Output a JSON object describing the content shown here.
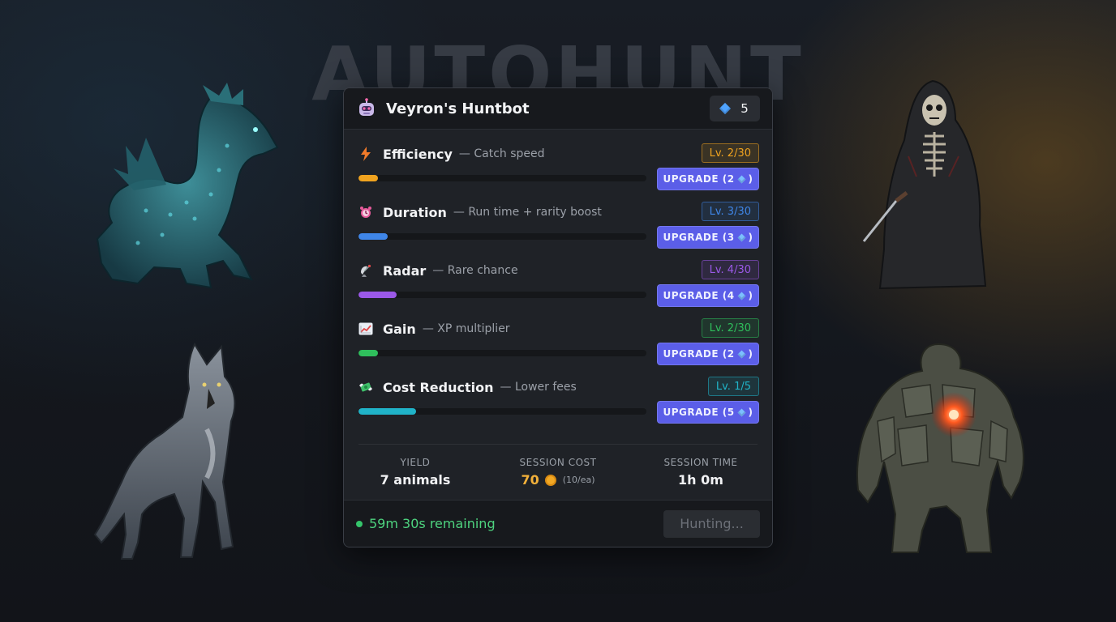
{
  "background_title": "AUTOHUNT",
  "panel": {
    "title": "Veyron's Huntbot",
    "gems": "5"
  },
  "stats": [
    {
      "name": "Efficiency",
      "desc": "— Catch speed",
      "level": "Lv. 2/30",
      "upgrade": "UPGRADE (2",
      "upgrade_end": ")",
      "progress": 0.067,
      "color": "#f0a31f",
      "icon": "lightning-icon"
    },
    {
      "name": "Duration",
      "desc": "— Run time + rarity boost",
      "level": "Lv. 3/30",
      "upgrade": "UPGRADE (3",
      "upgrade_end": ")",
      "progress": 0.1,
      "color": "#3f86e8",
      "icon": "alarm-clock-icon"
    },
    {
      "name": "Radar",
      "desc": "— Rare chance",
      "level": "Lv. 4/30",
      "upgrade": "UPGRADE (4",
      "upgrade_end": ")",
      "progress": 0.133,
      "color": "#9b59e8",
      "icon": "satellite-dish-icon"
    },
    {
      "name": "Gain",
      "desc": "— XP multiplier",
      "level": "Lv. 2/30",
      "upgrade": "UPGRADE (2",
      "upgrade_end": ")",
      "progress": 0.067,
      "color": "#2fbf5c",
      "icon": "chart-up-icon"
    },
    {
      "name": "Cost Reduction",
      "desc": "— Lower fees",
      "level": "Lv. 1/5",
      "upgrade": "UPGRADE (5",
      "upgrade_end": ")",
      "progress": 0.2,
      "color": "#20b3c8",
      "icon": "money-wings-icon"
    }
  ],
  "summary": {
    "yield_label": "YIELD",
    "yield_value": "7 animals",
    "cost_label": "SESSION COST",
    "cost_value": "70",
    "cost_rate": "(10/ea)",
    "time_label": "SESSION TIME",
    "time_value": "1h 0m"
  },
  "footer": {
    "status": "59m 30s remaining",
    "button": "Hunting..."
  },
  "colors": {
    "accent": "#5b5ee8",
    "gem": "#4fa3ff",
    "status_green": "#4ed37f",
    "coin": "#f1a825"
  }
}
